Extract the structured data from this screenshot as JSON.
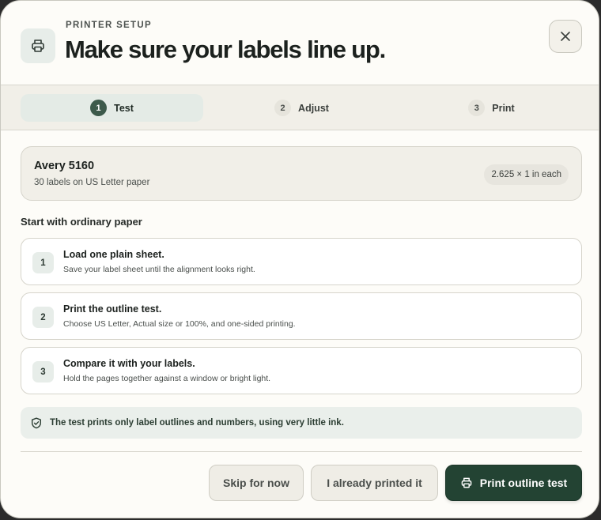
{
  "header": {
    "icon": "printer-icon",
    "eyebrow": "PRINTER SETUP",
    "title": "Make sure your labels line up.",
    "close_icon": "close-icon"
  },
  "stepper": {
    "active_step": 1,
    "steps": [
      {
        "num": "1",
        "label": "Test"
      },
      {
        "num": "2",
        "label": "Adjust"
      },
      {
        "num": "3",
        "label": "Print"
      }
    ]
  },
  "paper": {
    "name": "Avery 5160",
    "description": "30 labels on US Letter paper",
    "size": "2.625 × 1 in each"
  },
  "instructions": {
    "heading": "Start with ordinary paper",
    "items": [
      {
        "num": "1",
        "title": "Load one plain sheet.",
        "desc": "Save your label sheet until the alignment looks right."
      },
      {
        "num": "2",
        "title": "Print the outline test.",
        "desc": "Choose US Letter, Actual size or 100%, and one-sided printing."
      },
      {
        "num": "3",
        "title": "Compare it with your labels.",
        "desc": "Hold the pages together against a window or bright light."
      }
    ]
  },
  "note": {
    "icon": "shield-check-icon",
    "text": "The test prints only label outlines and numbers, using very little ink."
  },
  "footer": {
    "skip_label": "Skip for now",
    "already_label": "I already printed it",
    "print_label": "Print outline test",
    "print_icon": "printer-icon"
  },
  "colors": {
    "accent": "#234333",
    "active_step": "#3d5a4b",
    "background": "#fdfcf8",
    "panel": "#f1efe8",
    "note_bg": "#eaefeb"
  }
}
